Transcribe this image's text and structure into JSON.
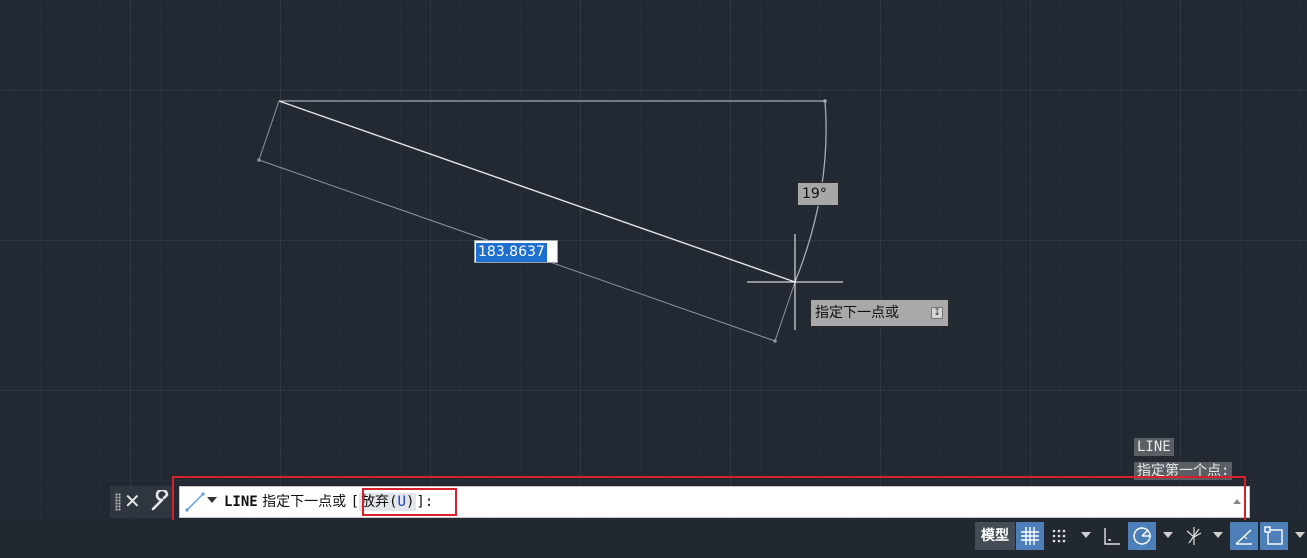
{
  "canvas": {
    "dynamic_input_value": "183.8637",
    "angle_tooltip": "19°",
    "prompt_tooltip": "指定下一点或",
    "prompt_tooltip_icon": "download-options-icon"
  },
  "command_history": [
    "LINE",
    "指定第一个点:"
  ],
  "command_line": {
    "command": "LINE",
    "prompt": "指定下一点或",
    "bracket_open": "[",
    "option_label": "放弃(",
    "option_key": "U",
    "option_close": ")",
    "bracket_close": "]:",
    "icon": "line-icon"
  },
  "status_bar": {
    "model_tab": "模型",
    "buttons": [
      {
        "name": "grid-icon",
        "active": true
      },
      {
        "name": "snap-icon",
        "active": false
      },
      {
        "name": "ortho-icon",
        "active": false
      },
      {
        "name": "polar-icon",
        "active": true
      },
      {
        "name": "isometric-icon",
        "active": false
      },
      {
        "name": "object-snap-tracking-icon",
        "active": true
      },
      {
        "name": "object-snap-icon",
        "active": true
      }
    ]
  },
  "colors": {
    "canvas_bg": "#222933",
    "highlight": "#d8202a",
    "active_button": "#4d7fb8",
    "selection": "#1f6fd1"
  }
}
